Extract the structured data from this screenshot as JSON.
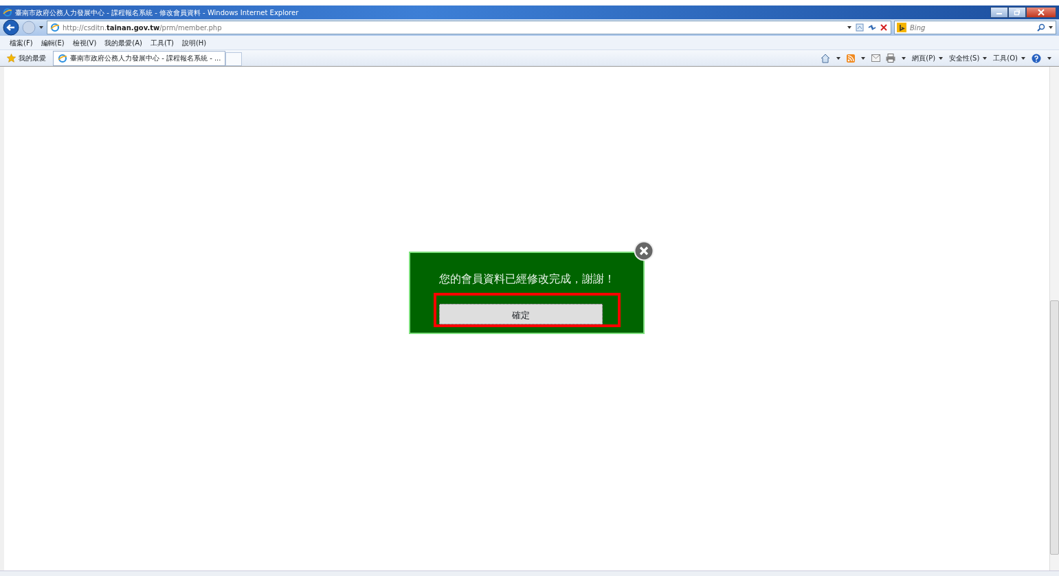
{
  "window": {
    "title": "臺南市政府公務人力發展中心 - 課程報名系統 - 修改會員資料 - Windows Internet Explorer"
  },
  "address_bar": {
    "url": "http://csditn.**tainan.gov.tw**/prm/member.php"
  },
  "search": {
    "placeholder": "Bing"
  },
  "menu": [
    "檔案(F)",
    "編輯(E)",
    "檢視(V)",
    "我的最愛(A)",
    "工具(T)",
    "說明(H)"
  ],
  "favorites": {
    "label": "我的最愛"
  },
  "tabs": [
    {
      "label": "臺南市政府公務人力發展中心 - 課程報名系統 - ...",
      "selected": true
    }
  ],
  "command_bar": [
    "網頁(P)",
    "安全性(S)",
    "工具(O)"
  ],
  "dialog": {
    "message": "您的會員資料已經修改完成，謝謝！",
    "button": "確定"
  }
}
